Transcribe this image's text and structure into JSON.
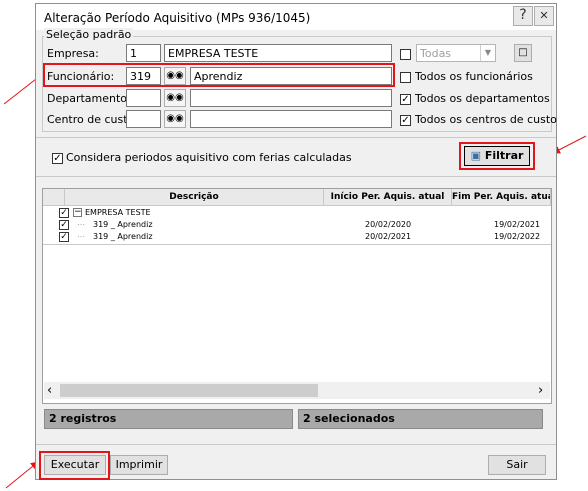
{
  "window": {
    "title": "Alteração Período Aquisitivo (MPs 936/1045)",
    "help_label": "?",
    "close_label": "✕"
  },
  "selection": {
    "legend": "Seleção padrão",
    "empresa": {
      "label": "Empresa:",
      "code": "1",
      "name": "EMPRESA TESTE"
    },
    "funcionario": {
      "label": "Funcionário:",
      "code": "319",
      "name": "Aprendiz"
    },
    "departamento": {
      "label": "Departamento:",
      "code": "",
      "name": ""
    },
    "centro_custo": {
      "label": "Centro de custo:",
      "code": "",
      "name": ""
    },
    "todas": {
      "checked": false,
      "select_value": "Todas"
    },
    "todos_funcionarios": {
      "label": "Todos os funcionários",
      "checked": false
    },
    "todos_departamentos": {
      "label": "Todos os departamentos",
      "checked": true
    },
    "todos_centros": {
      "label": "Todos os centros de custo",
      "checked": true
    }
  },
  "options": {
    "considera_label": "Considera periodos aquisitivo com ferias calculadas",
    "considera_checked": true,
    "filtrar_label": "Filtrar"
  },
  "grid": {
    "columns": [
      "Descrição",
      "Início Per. Aquis. atual",
      "Fim Per. Aquis. atual"
    ],
    "rows": [
      {
        "checked": true,
        "expander": "−",
        "descricao": "EMPRESA TESTE",
        "inicio": "",
        "fim": ""
      },
      {
        "checked": true,
        "expander": "",
        "descricao": "319 _ Aprendiz",
        "inicio": "20/02/2020",
        "fim": "19/02/2021"
      },
      {
        "checked": true,
        "expander": "",
        "descricao": "319 _ Aprendiz",
        "inicio": "20/02/2021",
        "fim": "19/02/2022"
      }
    ],
    "scroll_left": "‹",
    "scroll_right": "›"
  },
  "status": {
    "registros": "2 registros",
    "selecionados": "2 selecionados"
  },
  "buttons": {
    "executar": "Executar",
    "imprimir": "Imprimir",
    "sair": "Sair"
  },
  "colors": {
    "annotation": "#e0161b",
    "status_bg": "#a9a9a9"
  }
}
